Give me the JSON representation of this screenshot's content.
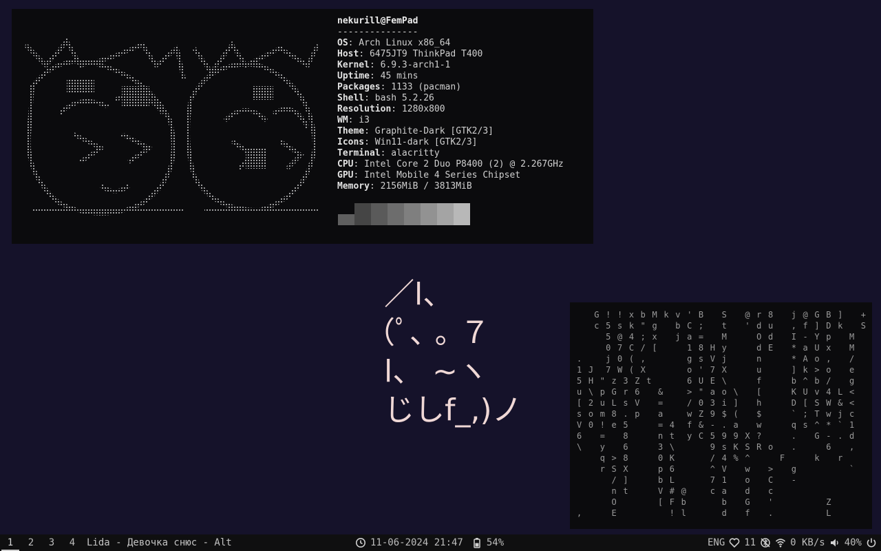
{
  "neofetch": {
    "user_host": "nekurill@FemPad",
    "separator": "---------------",
    "rows": [
      {
        "key": "OS",
        "value": ": Arch Linux x86_64"
      },
      {
        "key": "Host",
        "value": ": 6475JT9 ThinkPad T400"
      },
      {
        "key": "Kernel",
        "value": ": 6.9.3-arch1-1"
      },
      {
        "key": "Uptime",
        "value": ": 45 mins"
      },
      {
        "key": "Packages",
        "value": ": 1133 (pacman)"
      },
      {
        "key": "Shell",
        "value": ": bash 5.2.26"
      },
      {
        "key": "Resolution",
        "value": ": 1280x800"
      },
      {
        "key": "WM",
        "value": ": i3"
      },
      {
        "key": "Theme",
        "value": ": Graphite-Dark [GTK2/3]"
      },
      {
        "key": "Icons",
        "value": ": Win11-dark [GTK2/3]"
      },
      {
        "key": "Terminal",
        "value": ": alacritty"
      },
      {
        "key": "CPU",
        "value": ": Intel Core 2 Duo P8400 (2) @ 2.267GHz"
      },
      {
        "key": "GPU",
        "value": ": Intel Mobile 4 Series Chipset"
      },
      {
        "key": "Memory",
        "value": ": 2156MiB / 3813MiB"
      }
    ],
    "palette": [
      "#5f5f5f",
      "#454545",
      "#5a5a5a",
      "#6d6d6d",
      "#7f7f7f",
      "#929292",
      "#a4a4a4",
      "#b8b8b8"
    ]
  },
  "kaomoji": {
    "lines": [
      "  ／l、",
      "（ﾟ､ ｡ ７",
      "  l、 ~ヽ",
      "  じしf_,)ノ"
    ]
  },
  "matrix": {
    "lines": [
      "   G ! ! x b M k v ' B   S   @ r 8   j @ G B ]   +",
      "   c 5 s k \" g   b C ;   t   ' d u   , f ] D k   S",
      "     5 @ 4 ; x   j a =   M     O d   I - Y p   M",
      "     0 7 C / [     1 8 H y     d E   * a U x   M",
      ".    j 0 ( ,       g s V j     n     * A o ,   /",
      "1 J  7 W ( X       o ' 7 X     u     ] k > o   e",
      "5 H \" z 3 Z t      6 U E \\     f     b ^ b /   g",
      "u \\ p G r 6   &    > \" a o \\   [     K U v 4 L <",
      "[ 2 u L s V   =    / 0 3 i ]   h     D [ S W & <",
      "s o m 8 . p   a    w Z 9 $ (   $     ` ; T w j c",
      "V 0 ! e 5     = 4  f & - . a   w     q s ^ * ` 1",
      "6   =   8     n t  y C 5 9 9 X ?     .   G - . d",
      "\\   y   6     3 \\      9 s K S R o   .     6   ,",
      "    q > 8     0 K      / 4 % ^     F     k   r",
      "    r S X     p 6      ^ V   w   >   g         `",
      "      / ]     b L      7 1   o   C   -",
      "      n t     V # @    c a   d   c",
      "      O       [ F b      b   G   '         Z",
      ",     E         ! l      d   f   .         L"
    ]
  },
  "bar": {
    "workspaces": [
      "1",
      "2",
      "3",
      "4"
    ],
    "window_title": "Lida - Девочка снюс - Alt",
    "datetime": "11-06-2024 21:47",
    "battery": "54%",
    "keyboard_layout": "ENG",
    "updates": "11",
    "network_speed": "0 KB/s",
    "volume": "40%"
  }
}
